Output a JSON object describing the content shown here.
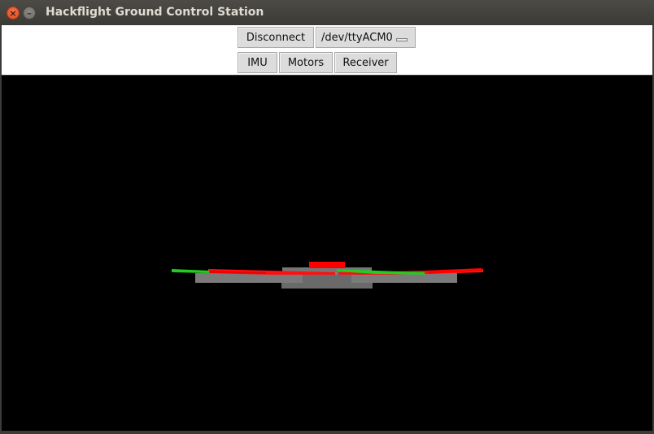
{
  "window": {
    "title": "Hackflight Ground Control Station"
  },
  "toolbar": {
    "connect_label": "Disconnect",
    "port_selected": "/dev/ttyACM0",
    "tabs": [
      {
        "label": "IMU"
      },
      {
        "label": "Motors"
      },
      {
        "label": "Receiver"
      }
    ]
  },
  "canvas": {
    "background": "#000000",
    "vehicle_colors": {
      "front_arms": "#ff0000",
      "rear_arms": "#22cc22",
      "body": "#707070"
    }
  },
  "icons": {
    "close": "close-icon",
    "minimize": "minimize-icon"
  }
}
